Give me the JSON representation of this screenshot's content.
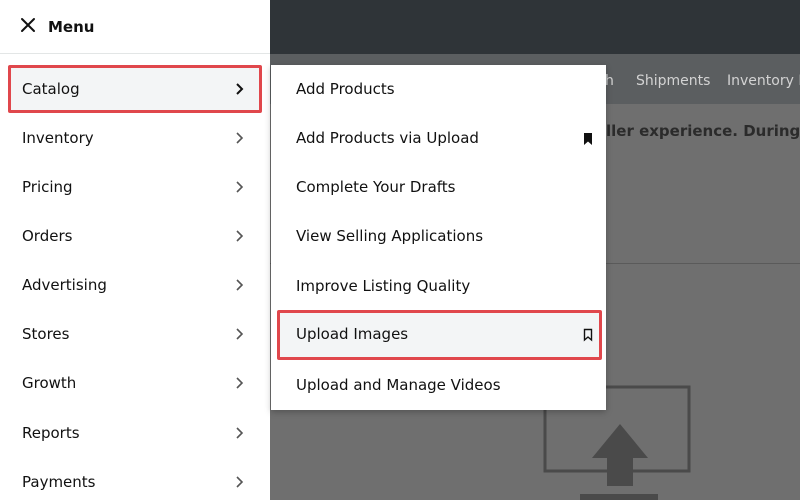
{
  "background": {
    "nav_items": [
      {
        "label": "h"
      },
      {
        "label": "Shipments"
      },
      {
        "label": "Inventory R"
      }
    ],
    "banner_text": "ller experience. During the"
  },
  "sidenav": {
    "close_icon": "close-icon",
    "title": "Menu",
    "items": [
      {
        "label": "Catalog",
        "active": true
      },
      {
        "label": "Inventory"
      },
      {
        "label": "Pricing"
      },
      {
        "label": "Orders"
      },
      {
        "label": "Advertising"
      },
      {
        "label": "Stores"
      },
      {
        "label": "Growth"
      },
      {
        "label": "Reports"
      },
      {
        "label": "Payments"
      }
    ]
  },
  "flyout": {
    "items": [
      {
        "label": "Add Products"
      },
      {
        "label": "Add Products via Upload",
        "bookmark": "filled"
      },
      {
        "label": "Complete Your Drafts"
      },
      {
        "label": "View Selling Applications"
      },
      {
        "label": "Improve Listing Quality"
      },
      {
        "label": "Upload Images",
        "bookmark": "outline",
        "active": true
      },
      {
        "label": "Upload and Manage Videos"
      }
    ]
  },
  "colors": {
    "highlight_border": "#e0474c",
    "top_bar": "#2f3438",
    "overlay": "#6f6f6f"
  }
}
